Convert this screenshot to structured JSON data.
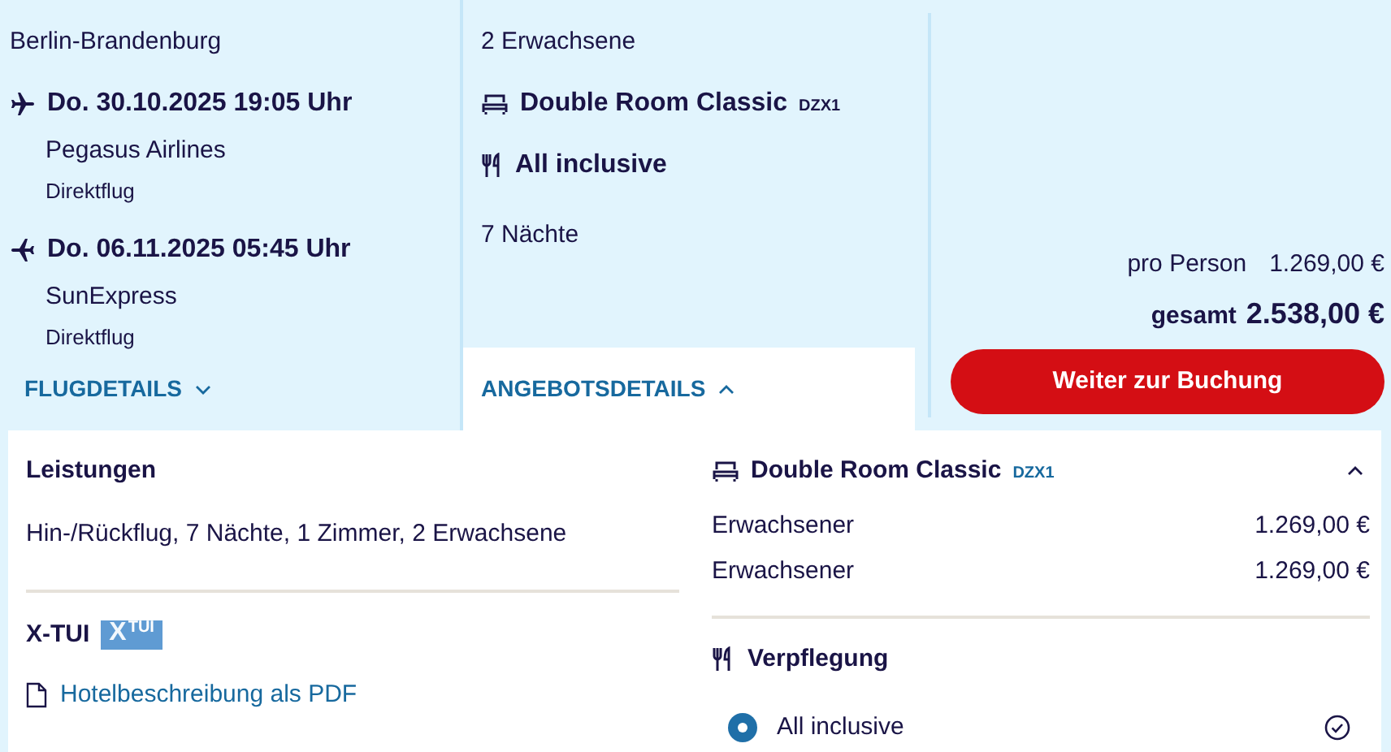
{
  "summary": {
    "airport": "Berlin-Brandenburg",
    "flights": [
      {
        "kind": "outbound",
        "datetime": "Do. 30.10.2025 19:05 Uhr",
        "airline": "Pegasus Airlines",
        "type": "Direktflug"
      },
      {
        "kind": "return",
        "datetime": "Do. 06.11.2025 05:45 Uhr",
        "airline": "SunExpress",
        "type": "Direktflug"
      }
    ],
    "travellers": "2 Erwachsene",
    "room": {
      "name": "Double Room Classic",
      "code": "DZX1"
    },
    "board": "All inclusive",
    "nights": "7 Nächte",
    "price_per_person_label": "pro Person",
    "price_per_person": "1.269,00 €",
    "total_label": "gesamt",
    "total": "2.538,00 €",
    "book_button": "Weiter zur Buchung"
  },
  "tabs": [
    {
      "label": "FLUGDETAILS",
      "selected": false
    },
    {
      "label": "ANGEBOTSDETAILS",
      "selected": true
    }
  ],
  "details": {
    "services_title": "Leistungen",
    "services_text": "Hin-/Rückflug, 7 Nächte, 1 Zimmer, 2 Erwachsene",
    "brand": "X-TUI",
    "badge": {
      "letter": "X",
      "super": "TUI"
    },
    "pdf_link": "Hotelbeschreibung als PDF",
    "room": {
      "name": "Double Room Classic",
      "code": "DZX1",
      "expanded": true,
      "lines": [
        {
          "label": "Erwachsener",
          "price": "1.269,00 €"
        },
        {
          "label": "Erwachsener",
          "price": "1.269,00 €"
        }
      ]
    },
    "board_title": "Verpflegung",
    "board_options": [
      {
        "label": "All inclusive",
        "selected": true
      }
    ]
  }
}
